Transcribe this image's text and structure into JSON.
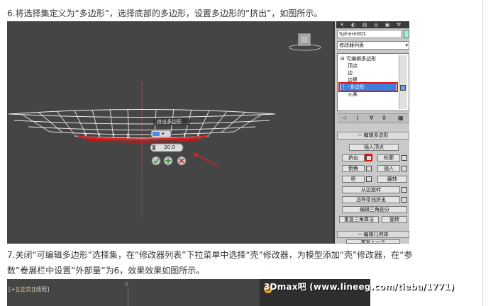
{
  "step6": {
    "text": "6.将选择集定义为“多边形”，选择底部的多边形，设置多边形的“挤出”，如图所示。"
  },
  "viewport": {
    "extrude_caption": "挤出多边形",
    "extrude_value": "20.0"
  },
  "command_panel": {
    "object_name": "Sphere001",
    "modifier_list": "修改器列表",
    "stack_items": [
      "可编辑多边形",
      "顶点",
      "边",
      "边界",
      "多边形",
      "元素"
    ],
    "selected_index": 4,
    "rollout_title": "编辑多边形",
    "buttons": {
      "insert_vertex": "插入顶点",
      "extrude": "挤出",
      "outline": "轮廓",
      "bevel": "倒角",
      "inset": "插入",
      "bridge": "桥",
      "flip": "翻转",
      "hinge": "从边旋转",
      "extrude_along_spline": "沿样条线挤出",
      "edit_triangulation": "编辑三角剖分",
      "retriangulate": "重复三角算法",
      "turn": "旋转"
    },
    "rollout2_title": "编辑几何体",
    "rollout2_item": "重复上一个"
  },
  "step7": {
    "line1": "7.关闭“可编辑多边形”选择集，在“修改器列表”下拉菜单中选择“壳”修改器，为模型添加“壳”修改器，在“参",
    "line2": "数”卷展栏中设置“外部量”为6，效果效果如图所示。"
  },
  "viewport2": {
    "label_prefix": "[+]",
    "label_view": "[正交]",
    "label_mode": "[线框]",
    "axis": "Z"
  },
  "watermark": "3Dmax吧 (www.lineeg.com/tieba/1771)"
}
